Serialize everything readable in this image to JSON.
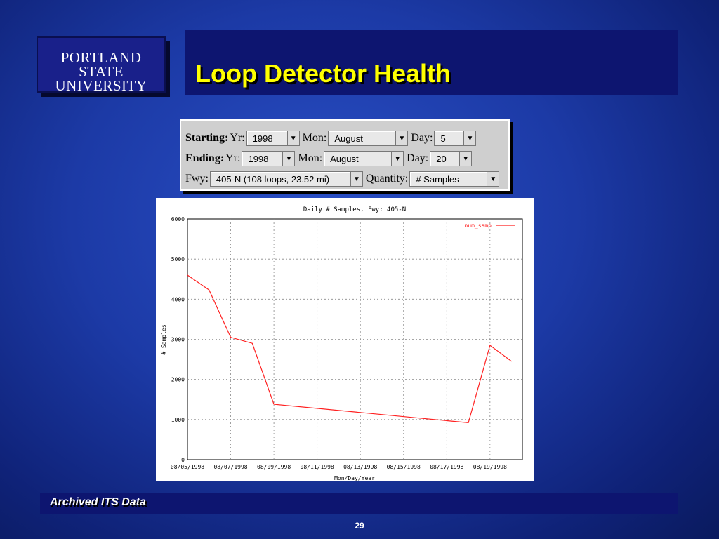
{
  "logo": {
    "line1": "PORTLAND STATE",
    "line2": "UNIVERSITY"
  },
  "slide": {
    "title": "Loop Detector Health",
    "footer": "Archived ITS Data",
    "page_number": "29"
  },
  "form": {
    "starting": {
      "label": "Starting:",
      "yr_label": "Yr:",
      "yr": "1998",
      "mon_label": "Mon:",
      "mon": "August",
      "day_label": "Day:",
      "day": "5"
    },
    "ending": {
      "label": "Ending:",
      "yr_label": "Yr:",
      "yr": "1998",
      "mon_label": "Mon:",
      "mon": "August",
      "day_label": "Day:",
      "day": "20"
    },
    "fwy_label": "Fwy:",
    "fwy": "405-N (108 loops, 23.52 mi)",
    "quantity_label": "Quantity:",
    "quantity": "# Samples"
  },
  "chart_data": {
    "type": "line",
    "title": "Daily # Samples, Fwy: 405-N",
    "xlabel": "Mon/Day/Year",
    "ylabel": "# Samples",
    "ylim": [
      0,
      6000
    ],
    "yticks": [
      "0",
      "1000",
      "2000",
      "3000",
      "4000",
      "5000",
      "6000"
    ],
    "xticks": [
      "08/05/1998",
      "08/07/1998",
      "08/09/1998",
      "08/11/1998",
      "08/13/1998",
      "08/15/1998",
      "08/17/1998",
      "08/19/1998"
    ],
    "grid": true,
    "legend_position": "top-right",
    "series": [
      {
        "name": "num_samp",
        "color": "#ff2020",
        "x": [
          "08/05/1998",
          "08/06/1998",
          "08/07/1998",
          "08/08/1998",
          "08/09/1998",
          "08/18/1998",
          "08/19/1998",
          "08/20/1998"
        ],
        "values": [
          4600,
          4230,
          3050,
          2900,
          1380,
          920,
          2850,
          2450
        ]
      }
    ]
  }
}
